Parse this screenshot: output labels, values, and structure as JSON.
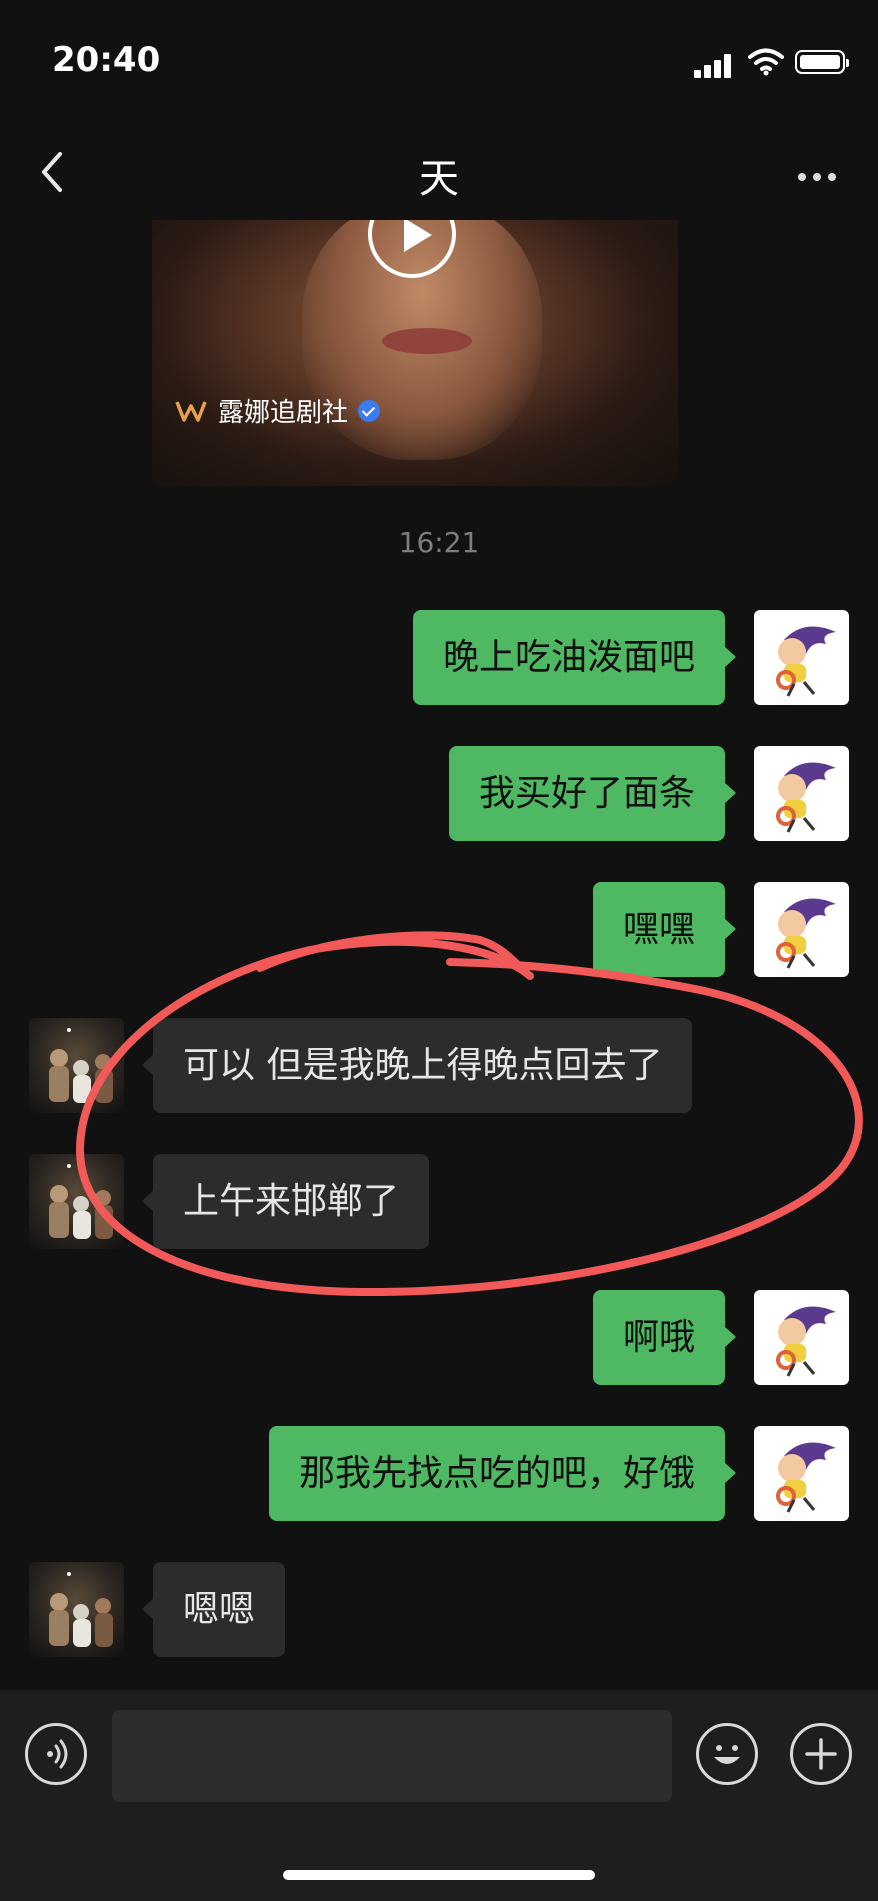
{
  "status_bar": {
    "time": "20:40",
    "battery_level": 1.0,
    "signal_bars": 4
  },
  "nav": {
    "title": "天",
    "back_icon": "chevron-left-icon",
    "more_icon": "more-icon"
  },
  "video_card": {
    "brand": "露娜追剧社",
    "brand_icon": "brand-logo-icon",
    "verified_icon": "verified-badge-icon",
    "play_icon": "play-icon"
  },
  "timestamp": "16:21",
  "messages": [
    {
      "side": "me",
      "text": "晚上吃油泼面吧"
    },
    {
      "side": "me",
      "text": "我买好了面条"
    },
    {
      "side": "me",
      "text": "嘿嘿"
    },
    {
      "side": "other",
      "text": "可以 但是我晚上得晚点回去了"
    },
    {
      "side": "other",
      "text": "上午来邯郸了"
    },
    {
      "side": "me",
      "text": "啊哦"
    },
    {
      "side": "me",
      "text": "那我先找点吃的吧，好饿"
    },
    {
      "side": "other",
      "text": "嗯嗯"
    }
  ],
  "annotation": {
    "color": "#f25a5a"
  },
  "input_bar": {
    "placeholder": "",
    "voice_icon": "voice-icon",
    "emoji_icon": "emoji-icon",
    "plus_icon": "plus-icon"
  },
  "colors": {
    "bubble_me": "#4eb962",
    "bubble_other": "#2c2c2c",
    "background": "#111111"
  }
}
